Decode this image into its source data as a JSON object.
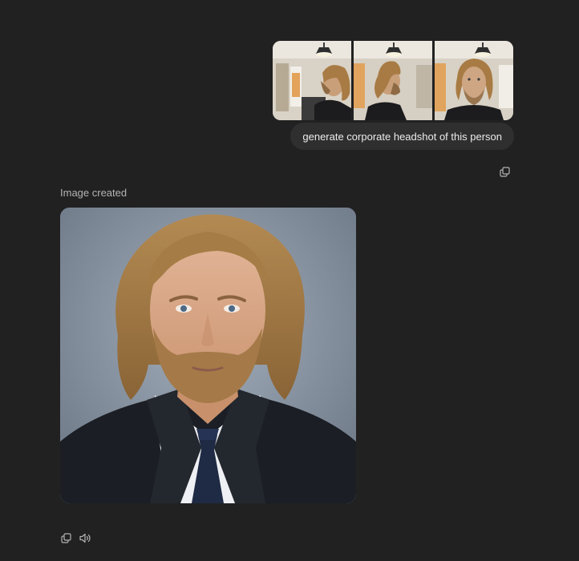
{
  "conversation": {
    "user_message": {
      "attachments": [
        {
          "kind": "photo",
          "icon": "profile-left-photo"
        },
        {
          "kind": "photo",
          "icon": "profile-right-photo"
        },
        {
          "kind": "photo",
          "icon": "front-facing-photo"
        }
      ],
      "text": "generate corporate headshot of this person",
      "actions": [
        {
          "icon": "copy-icon"
        }
      ]
    },
    "assistant_message": {
      "status": "Image created",
      "image": {
        "kind": "generated-headshot"
      },
      "actions": [
        {
          "icon": "copy-icon"
        },
        {
          "icon": "speaker-icon"
        }
      ]
    }
  },
  "colors": {
    "background": "#212121",
    "bubble": "#2f2f2f",
    "text": "#ececec",
    "muted": "#b4b4b4"
  }
}
